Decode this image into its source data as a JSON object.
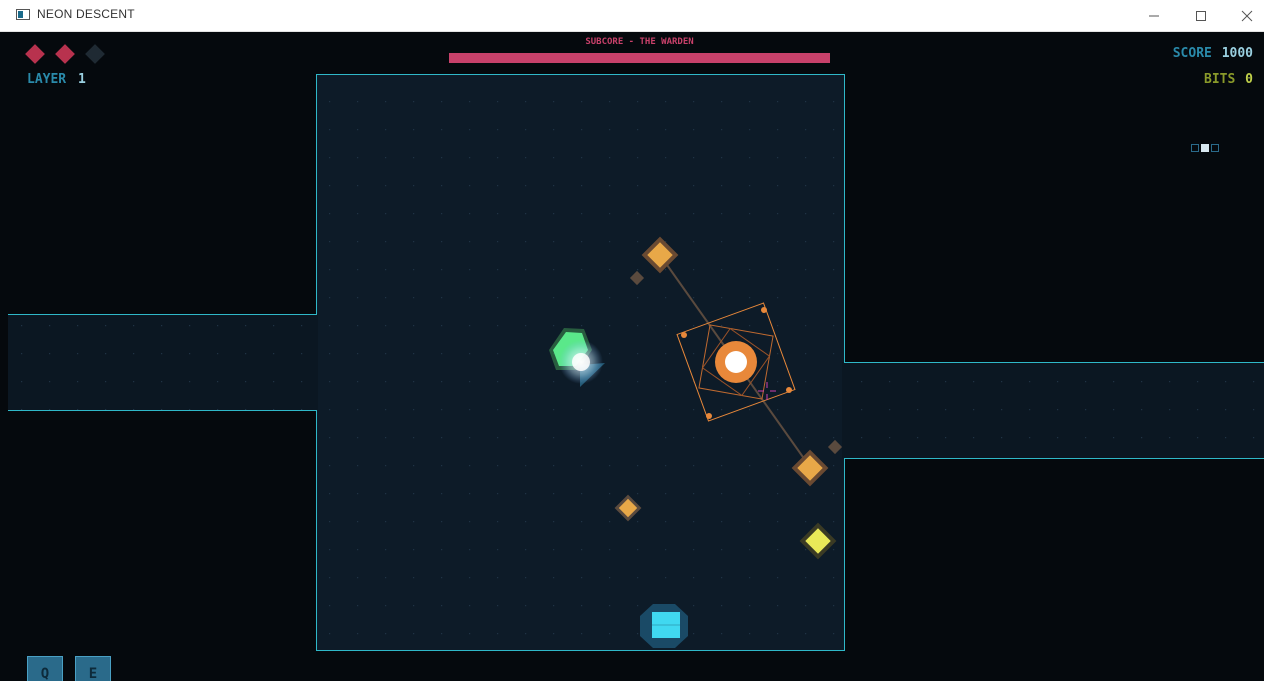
{
  "window": {
    "title": "NEON DESCENT",
    "controls": [
      "minimize",
      "maximize",
      "close"
    ]
  },
  "hud": {
    "hearts": [
      {
        "state": "full",
        "color": "#b8324e"
      },
      {
        "state": "full",
        "color": "#b8324e"
      },
      {
        "state": "empty",
        "color": "#1f2a33"
      }
    ],
    "layer_label": "LAYER",
    "layer_value": "1",
    "boss_name": "SUBCORE - THE WARDEN",
    "boss_health": 1.0,
    "boss_color": "#c8416a",
    "score_label": "SCORE",
    "score_value": "1000",
    "bits_label": "BITS",
    "bits_value": "0",
    "ability_keys": [
      "Q",
      "E"
    ]
  },
  "colors": {
    "wall": "#2fb8c8",
    "floor": "#0d1b28",
    "boss": "#e8883a",
    "player": "#4ad870",
    "item": "#e8e858"
  },
  "icons": [
    "heart-icon",
    "minimap-icon",
    "app-icon"
  ]
}
